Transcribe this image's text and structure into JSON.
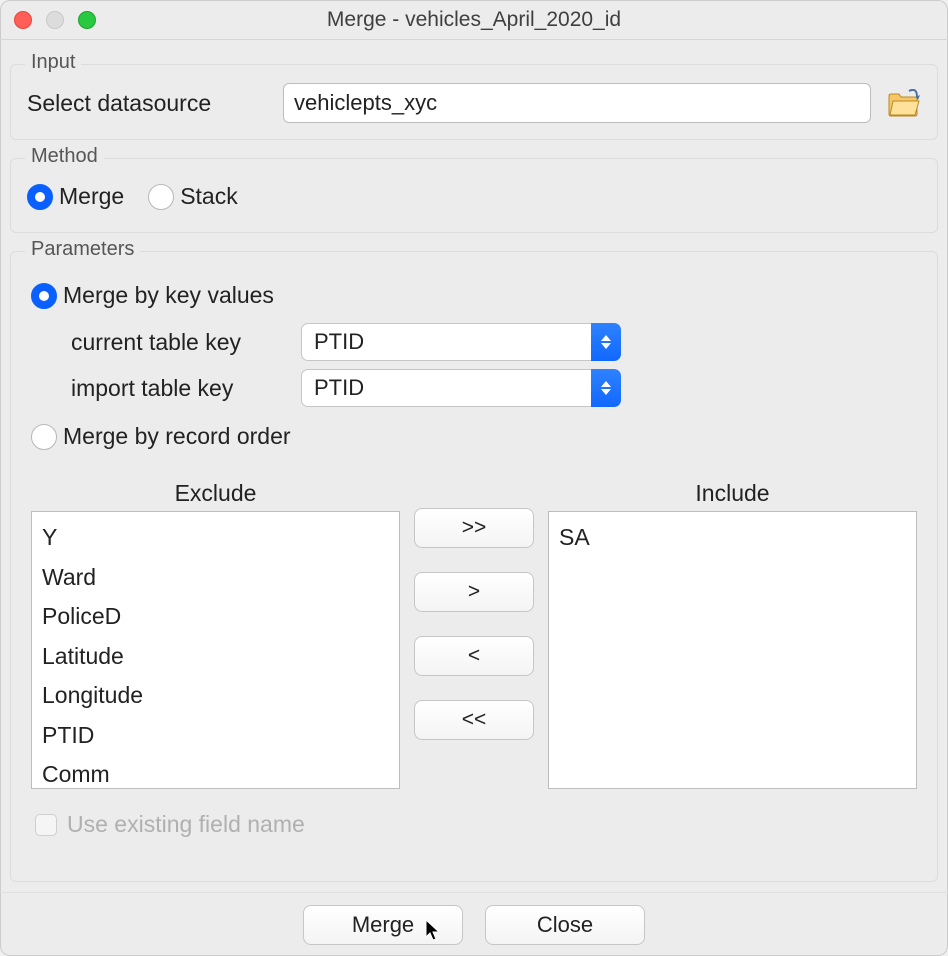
{
  "window": {
    "title": "Merge - vehicles_April_2020_id"
  },
  "input": {
    "section_label": "Input",
    "select_label": "Select datasource",
    "datasource_value": "vehiclepts_xyc"
  },
  "method": {
    "section_label": "Method",
    "opt_merge": "Merge",
    "opt_stack": "Stack",
    "selected": "merge"
  },
  "parameters": {
    "section_label": "Parameters",
    "opt_merge_key": "Merge by key values",
    "opt_record_order": "Merge by record order",
    "current_key_label": "current table key",
    "import_key_label": "import table key",
    "current_key_value": "PTID",
    "import_key_value": "PTID",
    "exclude_label": "Exclude",
    "include_label": "Include",
    "exclude_items": [
      "Y",
      "Ward",
      "PoliceD",
      "Latitude",
      "Longitude",
      "PTID",
      "Comm"
    ],
    "include_items": [
      "SA"
    ],
    "mover": {
      "all_right": ">>",
      "one_right": ">",
      "one_left": "<",
      "all_left": "<<"
    },
    "use_existing_label": "Use existing field name"
  },
  "footer": {
    "merge": "Merge",
    "close": "Close"
  }
}
